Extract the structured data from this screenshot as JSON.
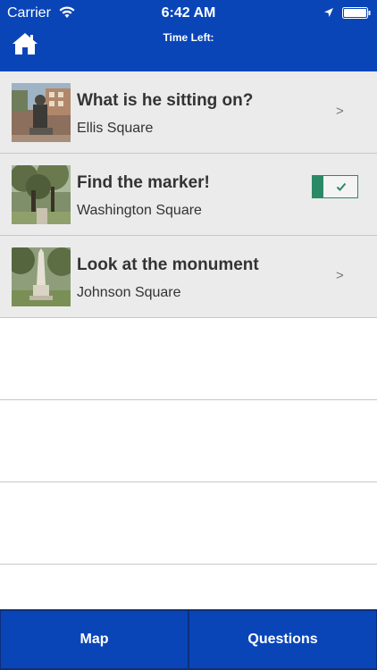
{
  "status_bar": {
    "carrier": "Carrier",
    "time": "6:42 AM"
  },
  "header": {
    "time_left_label": "Time Left:",
    "background_color": "#0a45b8"
  },
  "tasks": [
    {
      "title": "What is he sitting on?",
      "location": "Ellis Square",
      "completed": false,
      "action_icon": "chevron-right-icon"
    },
    {
      "title": "Find the marker!",
      "location": "Washington Square",
      "completed": true,
      "action_icon": "checkmark-icon"
    },
    {
      "title": "Look at the monument",
      "location": "Johnson Square",
      "completed": false,
      "action_icon": "chevron-right-icon"
    }
  ],
  "chevron_glyph": ">",
  "colors": {
    "accent_blue": "#0a45b8",
    "complete_green": "#2a8a65",
    "row_background": "#ebebeb"
  },
  "tabs": {
    "map_label": "Map",
    "questions_label": "Questions"
  }
}
